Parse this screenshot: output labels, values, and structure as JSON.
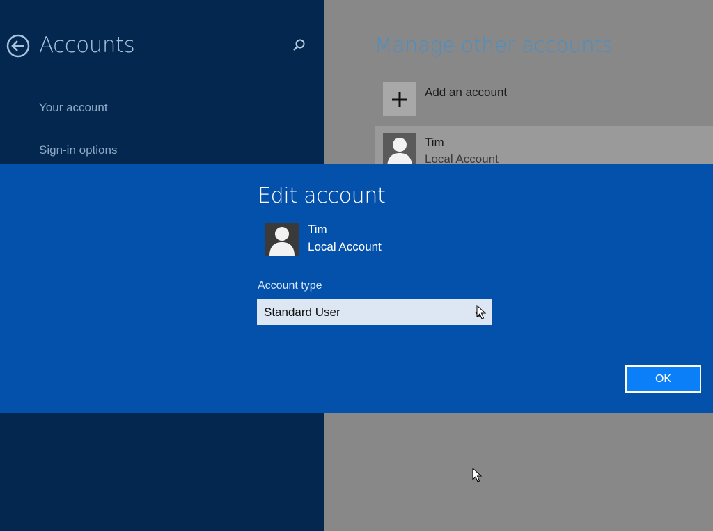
{
  "left_pane": {
    "title": "Accounts",
    "back_icon": "back-arrow-circle-icon",
    "search_icon": "search-icon",
    "nav_items": [
      "Your account",
      "Sign-in options"
    ],
    "background": "#03274e"
  },
  "right_pane": {
    "title": "Manage other accounts",
    "add_account": {
      "label": "Add an account",
      "icon": "plus-icon"
    },
    "accounts": [
      {
        "name": "Tim",
        "type": "Local Account",
        "icon": "user-avatar-icon"
      }
    ],
    "accent_color": "#4d8fc2"
  },
  "dialog": {
    "title": "Edit account",
    "user": {
      "name": "Tim",
      "type": "Local Account",
      "icon": "user-avatar-icon"
    },
    "account_type": {
      "label": "Account type",
      "selected": "Standard User"
    },
    "ok_label": "OK",
    "background": "#0451ab",
    "button_color": "#0b7ff7"
  }
}
